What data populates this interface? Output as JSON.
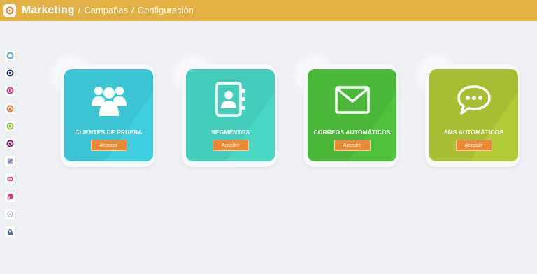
{
  "header": {
    "title": "Marketing",
    "breadcrumb": [
      "Campañas",
      "Configuración"
    ],
    "separator": "/"
  },
  "sidebar": {
    "items": [
      {
        "icon": "circle-arrow-icon",
        "color": "#4a9be0"
      },
      {
        "icon": "power-icon",
        "color": "#1e3050"
      },
      {
        "icon": "power-icon",
        "color": "#d83a8d"
      },
      {
        "icon": "power-icon",
        "color": "#e8772e"
      },
      {
        "icon": "power-icon",
        "color": "#8fc13a"
      },
      {
        "icon": "power-icon",
        "color": "#8a1e7a"
      },
      {
        "icon": "checklist-icon",
        "color": "#7a7fb8"
      },
      {
        "icon": "robot-icon",
        "color": "#d84070"
      },
      {
        "icon": "chat-bubble-icon",
        "color": "#c9408a"
      },
      {
        "icon": "gear-network-icon",
        "color": "#7a8ab8"
      },
      {
        "icon": "person-icon",
        "color": "#4c6a9a"
      }
    ]
  },
  "cards": [
    {
      "title": "CLIENTES DE PRUEBA",
      "button": "Acceder",
      "color": "#3ecfe0",
      "icon": "users-icon"
    },
    {
      "title": "SEGMENTOS",
      "button": "Acceder",
      "color": "#48d8c4",
      "icon": "contact-book-icon"
    },
    {
      "title": "CORREOS AUTOMÁTICOS",
      "button": "Acceder",
      "color": "#4ec13b",
      "icon": "envelope-icon"
    },
    {
      "title": "SMS AUTOMÁTICOS",
      "button": "Acceder",
      "color": "#b3c935",
      "icon": "speech-bubble-icon"
    }
  ]
}
